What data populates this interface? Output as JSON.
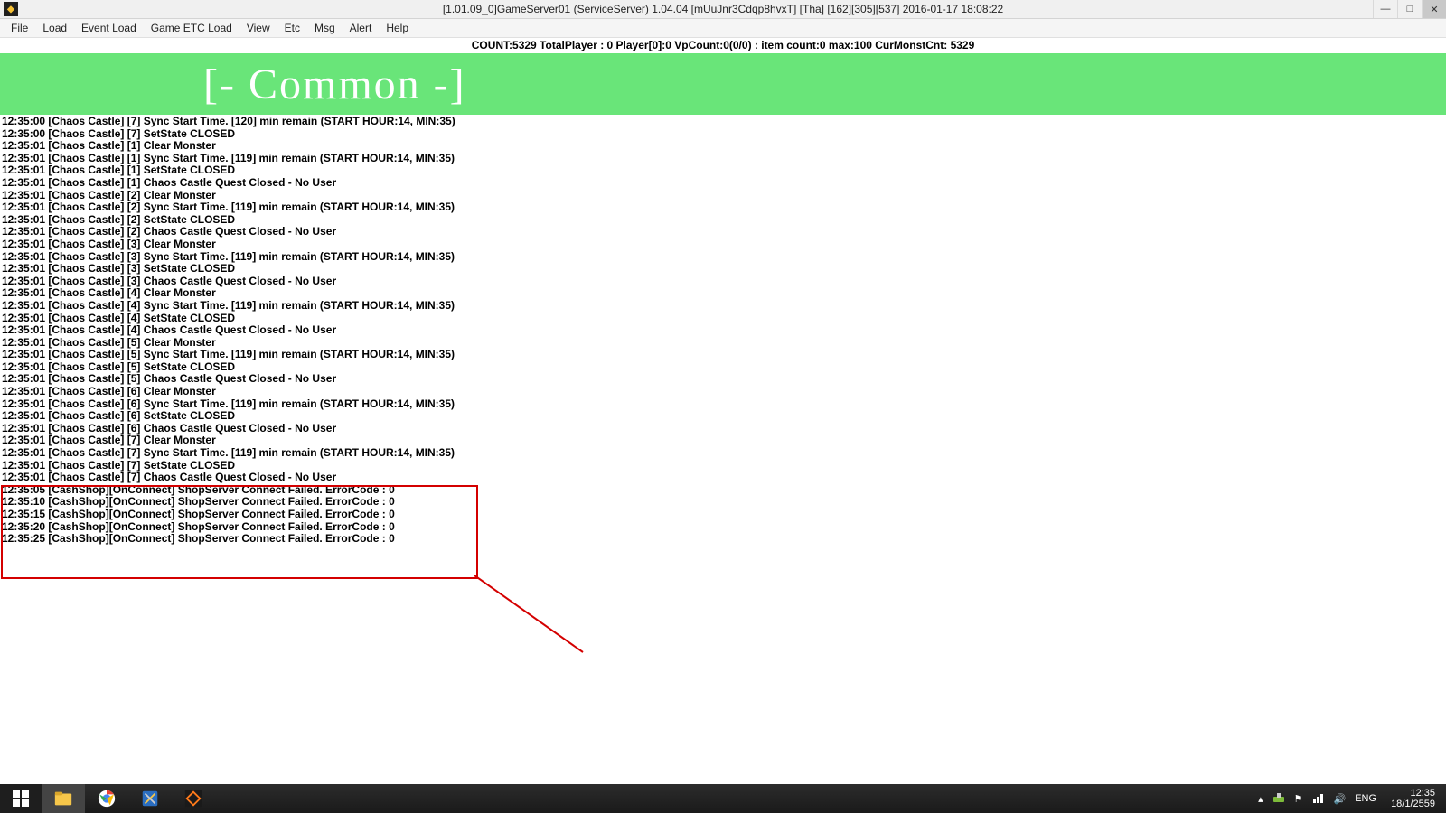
{
  "window": {
    "title": "[1.01.09_0]GameServer01 (ServiceServer) 1.04.04 [mUuJnr3Cdqp8hvxT] [Tha] [162][305][537] 2016-01-17 18:08:22"
  },
  "menu": {
    "items": [
      "File",
      "Load",
      "Event Load",
      "Game ETC Load",
      "View",
      "Etc",
      "Msg",
      "Alert",
      "Help"
    ]
  },
  "status_line": "COUNT:5329  TotalPlayer : 0  Player[0]:0 VpCount:0(0/0) : item count:0 max:100 CurMonstCnt: 5329",
  "banner_text": "[-  Common  -]",
  "log_lines": [
    "12:35:00 [Chaos Castle] [7] Sync Start Time. [120] min remain (START HOUR:14, MIN:35)",
    "12:35:00 [Chaos Castle] [7] SetState CLOSED",
    "12:35:01 [Chaos Castle] [1] Clear Monster",
    "12:35:01 [Chaos Castle] [1] Sync Start Time. [119] min remain (START HOUR:14, MIN:35)",
    "12:35:01 [Chaos Castle] [1] SetState CLOSED",
    "12:35:01 [Chaos Castle] [1] Chaos Castle Quest Closed - No User",
    "12:35:01 [Chaos Castle] [2] Clear Monster",
    "12:35:01 [Chaos Castle] [2] Sync Start Time. [119] min remain (START HOUR:14, MIN:35)",
    "12:35:01 [Chaos Castle] [2] SetState CLOSED",
    "12:35:01 [Chaos Castle] [2] Chaos Castle Quest Closed - No User",
    "12:35:01 [Chaos Castle] [3] Clear Monster",
    "12:35:01 [Chaos Castle] [3] Sync Start Time. [119] min remain (START HOUR:14, MIN:35)",
    "12:35:01 [Chaos Castle] [3] SetState CLOSED",
    "12:35:01 [Chaos Castle] [3] Chaos Castle Quest Closed - No User",
    "12:35:01 [Chaos Castle] [4] Clear Monster",
    "12:35:01 [Chaos Castle] [4] Sync Start Time. [119] min remain (START HOUR:14, MIN:35)",
    "12:35:01 [Chaos Castle] [4] SetState CLOSED",
    "12:35:01 [Chaos Castle] [4] Chaos Castle Quest Closed - No User",
    "12:35:01 [Chaos Castle] [5] Clear Monster",
    "12:35:01 [Chaos Castle] [5] Sync Start Time. [119] min remain (START HOUR:14, MIN:35)",
    "12:35:01 [Chaos Castle] [5] SetState CLOSED",
    "12:35:01 [Chaos Castle] [5] Chaos Castle Quest Closed - No User",
    "12:35:01 [Chaos Castle] [6] Clear Monster",
    "12:35:01 [Chaos Castle] [6] Sync Start Time. [119] min remain (START HOUR:14, MIN:35)",
    "12:35:01 [Chaos Castle] [6] SetState CLOSED",
    "12:35:01 [Chaos Castle] [6] Chaos Castle Quest Closed - No User",
    "12:35:01 [Chaos Castle] [7] Clear Monster",
    "12:35:01 [Chaos Castle] [7] Sync Start Time. [119] min remain (START HOUR:14, MIN:35)",
    "12:35:01 [Chaos Castle] [7] SetState CLOSED",
    "12:35:01 [Chaos Castle] [7] Chaos Castle Quest Closed - No User",
    "12:35:05 [CashShop][OnConnect] ShopServer Connect Failed. ErrorCode : 0",
    "12:35:10 [CashShop][OnConnect] ShopServer Connect Failed. ErrorCode : 0",
    "12:35:15 [CashShop][OnConnect] ShopServer Connect Failed. ErrorCode : 0",
    "12:35:20 [CashShop][OnConnect] ShopServer Connect Failed. ErrorCode : 0",
    "12:35:25 [CashShop][OnConnect] ShopServer Connect Failed. ErrorCode : 0"
  ],
  "taskbar": {
    "lang": "ENG",
    "clock_time": "12:35",
    "clock_date": "18/1/2559"
  }
}
